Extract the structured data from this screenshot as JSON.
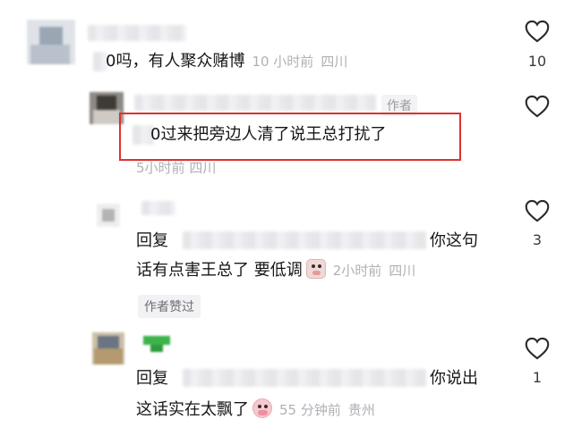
{
  "comments": [
    {
      "text": "0吗，有人聚众赌博",
      "time": "10 小时前",
      "location": "四川",
      "likes": "10"
    },
    {
      "author_tag": "作者",
      "text": "0过来把旁边人清了说王总打扰了",
      "time": "5小时前",
      "location": "四川"
    },
    {
      "reply_prefix": "回复",
      "text_tail": "你这句",
      "text_line2": "话有点害王总了  要低调",
      "time": "2小时前",
      "location": "四川",
      "likes": "3",
      "author_liked": "作者赞过"
    },
    {
      "reply_prefix": "回复",
      "text_tail": "你说出",
      "text_line2": "这话实在太飘了",
      "time": "55 分钟前",
      "location": "贵州",
      "likes": "1"
    }
  ],
  "icons": {
    "like": "heart-outline-icon",
    "emoji_1": "pig-face-emoji-icon",
    "emoji_2": "pig-face-emoji-icon"
  },
  "colors": {
    "highlight_border": "#e0302e",
    "meta_text": "#b0b0b6"
  }
}
